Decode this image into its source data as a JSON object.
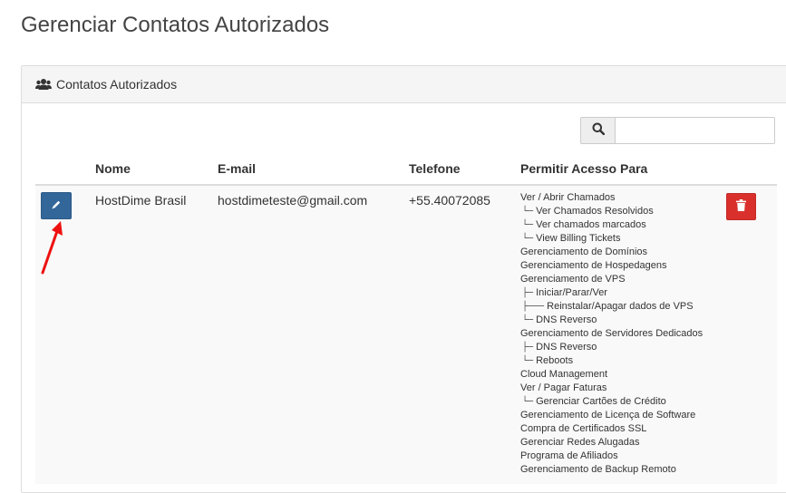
{
  "page": {
    "title": "Gerenciar Contatos Autorizados"
  },
  "panel": {
    "heading": "Contatos Autorizados",
    "heading_icon": "users-icon"
  },
  "search": {
    "placeholder": "",
    "value": "",
    "icon": "search-icon"
  },
  "table": {
    "columns": [
      "Nome",
      "E-mail",
      "Telefone",
      "Permitir Acesso Para"
    ],
    "rows": [
      {
        "name": "HostDime Brasil",
        "email": "hostdimeteste@gmail.com",
        "phone": "+55.40072085",
        "permissions": [
          {
            "prefix": "",
            "label": "Ver / Abrir Chamados"
          },
          {
            "prefix": "└─",
            "label": "Ver Chamados Resolvidos"
          },
          {
            "prefix": "└─",
            "label": "Ver chamados marcados"
          },
          {
            "prefix": "└─",
            "label": "View Billing Tickets"
          },
          {
            "prefix": "",
            "label": "Gerenciamento de Domínios"
          },
          {
            "prefix": "",
            "label": "Gerenciamento de Hospedagens"
          },
          {
            "prefix": "",
            "label": "Gerenciamento de VPS"
          },
          {
            "prefix": "├─",
            "label": "Iniciar/Parar/Ver"
          },
          {
            "prefix": "├───",
            "label": "Reinstalar/Apagar dados de VPS"
          },
          {
            "prefix": "└─",
            "label": "DNS Reverso"
          },
          {
            "prefix": "",
            "label": "Gerenciamento de Servidores Dedicados"
          },
          {
            "prefix": "├─",
            "label": "DNS Reverso"
          },
          {
            "prefix": "└─",
            "label": "Reboots"
          },
          {
            "prefix": "",
            "label": "Cloud Management"
          },
          {
            "prefix": "",
            "label": "Ver / Pagar Faturas"
          },
          {
            "prefix": "└─",
            "label": "Gerenciar Cartões de Crédito"
          },
          {
            "prefix": "",
            "label": "Gerenciamento de Licença de Software"
          },
          {
            "prefix": "",
            "label": "Compra de Certificados SSL"
          },
          {
            "prefix": "",
            "label": "Gerenciar Redes Alugadas"
          },
          {
            "prefix": "",
            "label": "Programa de Afiliados"
          },
          {
            "prefix": "",
            "label": "Gerenciamento de Backup Remoto"
          }
        ]
      }
    ]
  },
  "icons": {
    "edit": "pencil-icon",
    "delete": "trash-icon",
    "annotation": "red-arrow-icon"
  },
  "colors": {
    "edit_button": "#336699",
    "delete_button": "#d9302c",
    "arrow": "#ee1111"
  }
}
